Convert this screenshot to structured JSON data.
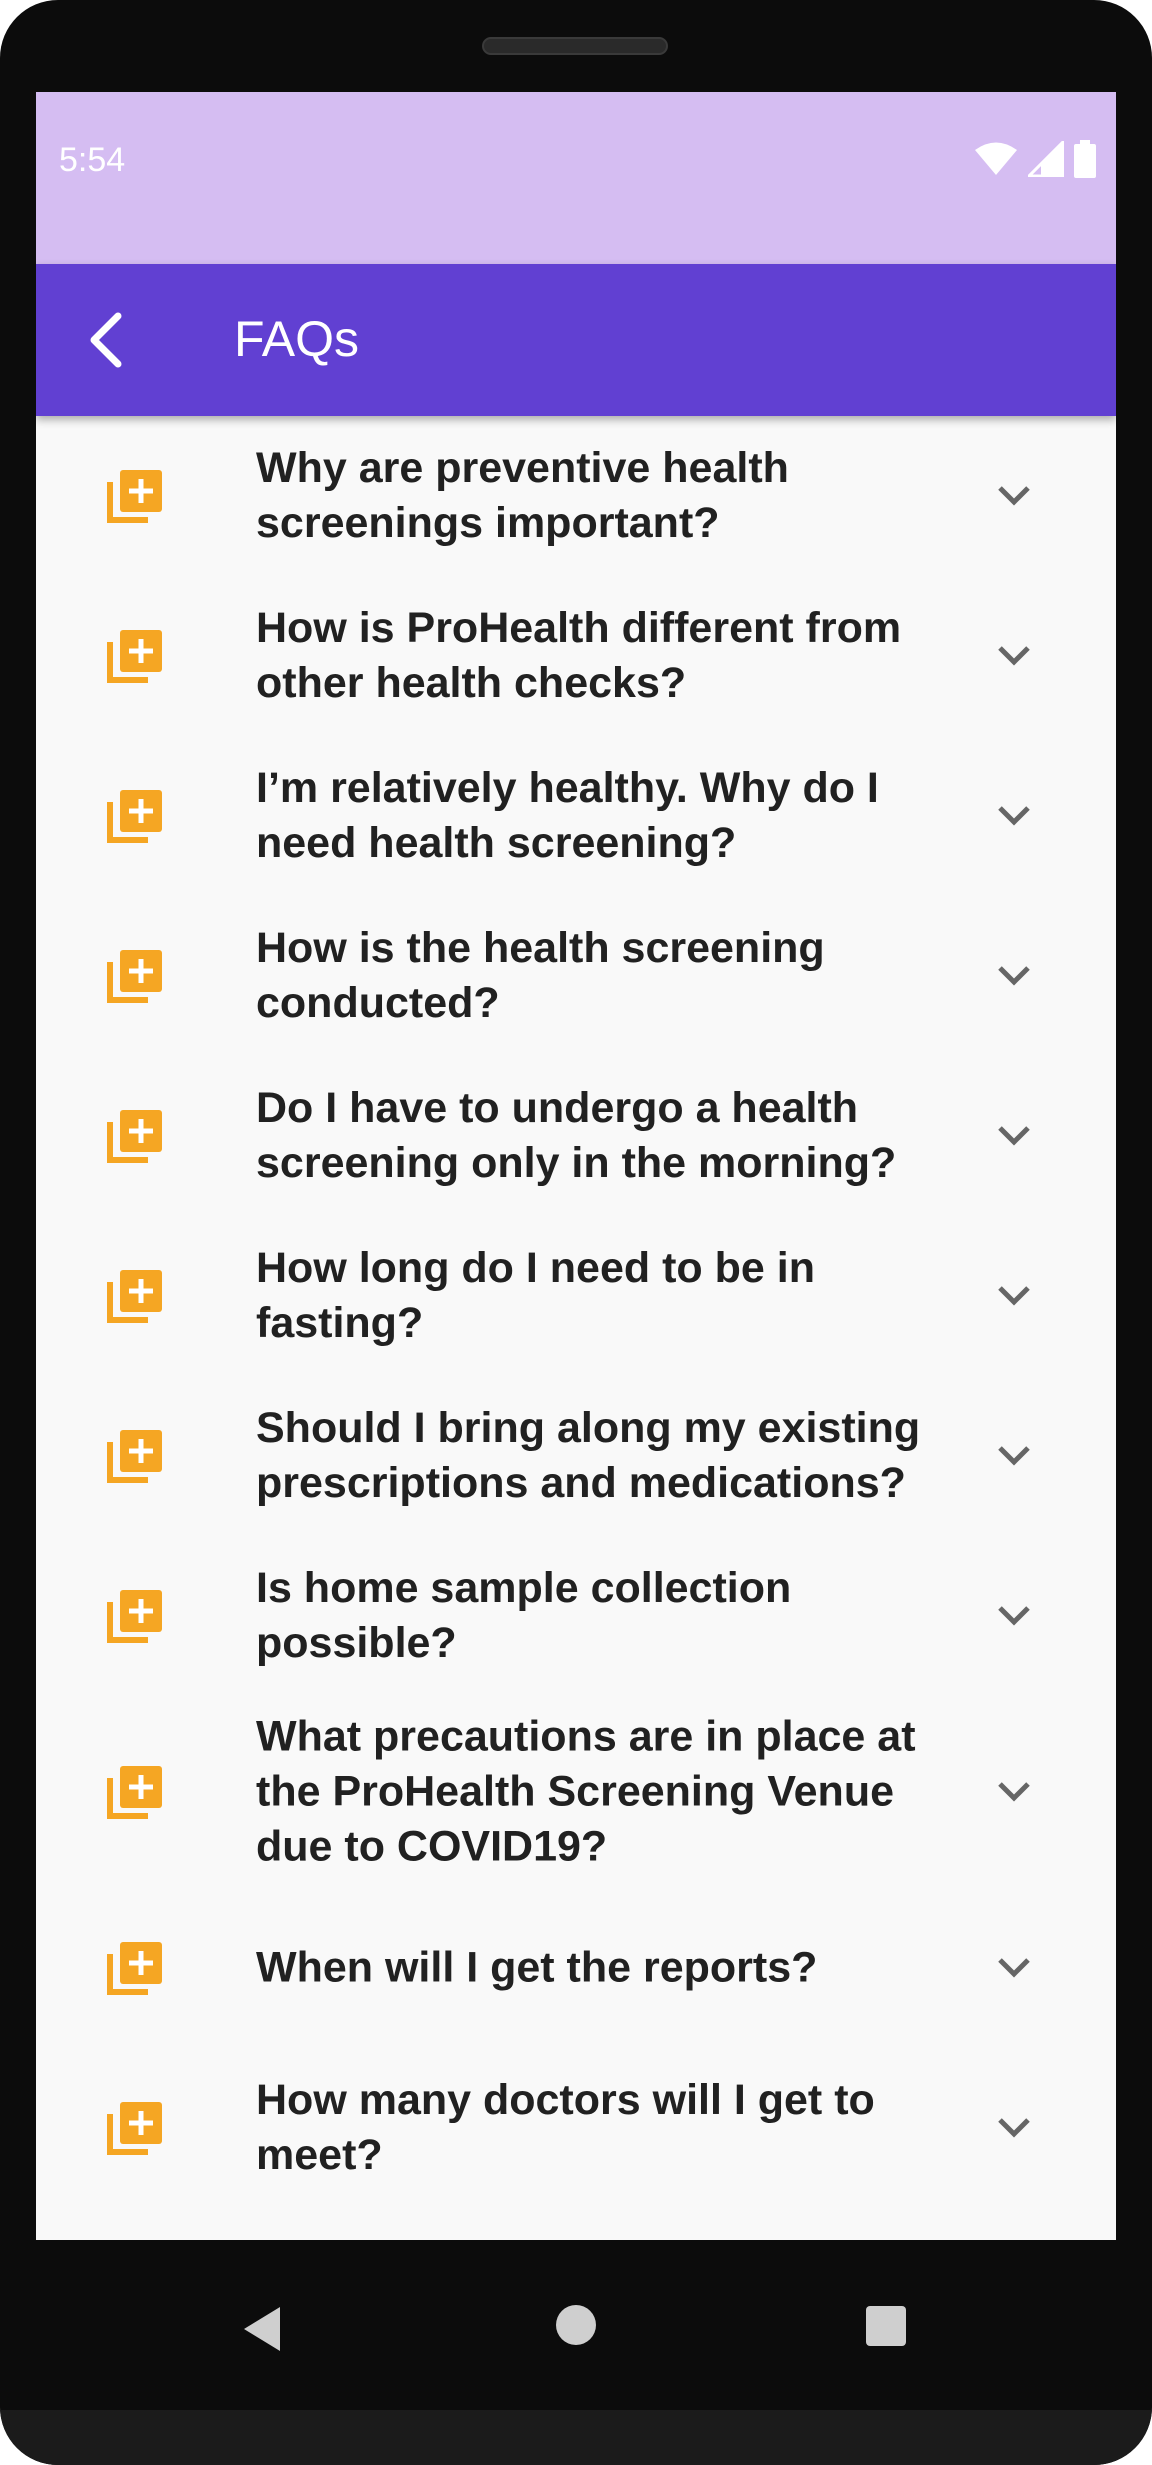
{
  "status_bar": {
    "time": "5:54",
    "icons": [
      "wifi-icon",
      "cell-signal-icon",
      "battery-icon"
    ]
  },
  "app_bar": {
    "back_icon": "arrow-back-icon",
    "title": "FAQs"
  },
  "colors": {
    "status_bar": "#d5bdf2",
    "app_bar": "#6140d2",
    "accent_icon": "#f5a623",
    "question_text": "#212121",
    "chevron": "#666666",
    "background": "#f9f9f9"
  },
  "faqs": [
    {
      "question": "Why are preventive health screenings important?",
      "icon": "library-add-icon",
      "expand_icon": "chevron-down-icon"
    },
    {
      "question": "How is ProHealth different from other health checks?",
      "icon": "library-add-icon",
      "expand_icon": "chevron-down-icon"
    },
    {
      "question": "I’m relatively healthy. Why do I need health screening?",
      "icon": "library-add-icon",
      "expand_icon": "chevron-down-icon"
    },
    {
      "question": "How is the health screening conducted?",
      "icon": "library-add-icon",
      "expand_icon": "chevron-down-icon"
    },
    {
      "question": "Do I have to undergo a health screening only in the morning?",
      "icon": "library-add-icon",
      "expand_icon": "chevron-down-icon"
    },
    {
      "question": "How long do I need to be in fasting?",
      "icon": "library-add-icon",
      "expand_icon": "chevron-down-icon"
    },
    {
      "question": "Should I bring along my existing prescriptions and medications?",
      "icon": "library-add-icon",
      "expand_icon": "chevron-down-icon"
    },
    {
      "question": "Is home sample collection possible?",
      "icon": "library-add-icon",
      "expand_icon": "chevron-down-icon"
    },
    {
      "question": "What precautions are in place at the ProHealth Screening Venue due to COVID19?",
      "icon": "library-add-icon",
      "expand_icon": "chevron-down-icon"
    },
    {
      "question": "When will I get the reports?",
      "icon": "library-add-icon",
      "expand_icon": "chevron-down-icon"
    },
    {
      "question": "How many doctors will I get to meet?",
      "icon": "library-add-icon",
      "expand_icon": "chevron-down-icon"
    }
  ],
  "nav_bar": {
    "buttons": [
      "nav-back-icon",
      "nav-home-icon",
      "nav-recents-icon"
    ]
  }
}
